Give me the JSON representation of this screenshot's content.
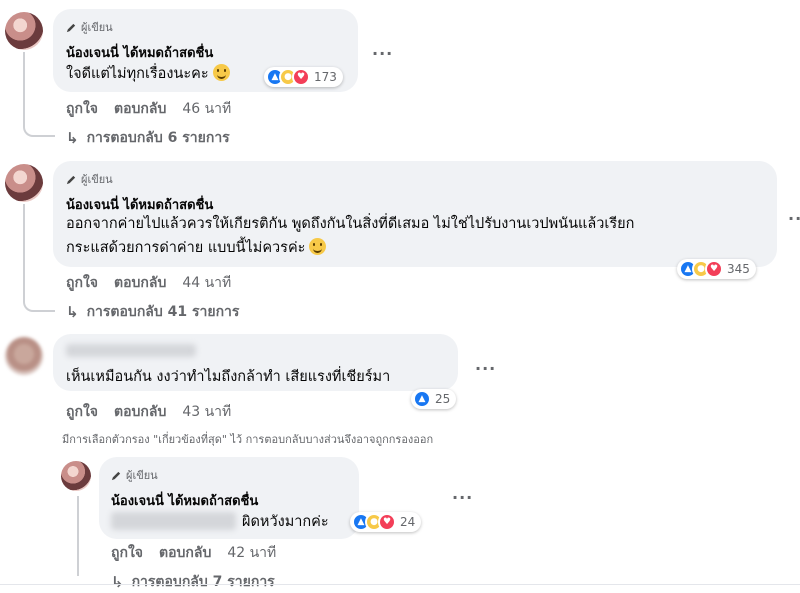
{
  "comments": [
    {
      "author_tag": "ผู้เขียน",
      "author": "น้องเจนนี่ ได้หมดถ้าสดชื่น",
      "lines": [
        "ใจดีแต่ไม่ทุกเรื่องนะคะ"
      ],
      "reaction_count": "173",
      "like_label": "ถูกใจ",
      "reply_label": "ตอบกลับ",
      "time": "46 นาที",
      "replies_text": "การตอบกลับ 6 รายการ"
    },
    {
      "author_tag": "ผู้เขียน",
      "author": "น้องเจนนี่ ได้หมดถ้าสดชื่น",
      "lines": [
        "ออกจากค่ายไปแล้วควรให้เกียรติกัน พูดถึงกันในสิ่งที่ดีเสมอ ไม่ใช่ไปรับงานเวปพนันแล้วเรียก",
        "กระแสด้วยการด่าค่าย แบบนี้ไม่ควรค่ะ"
      ],
      "reaction_count": "345",
      "like_label": "ถูกใจ",
      "reply_label": "ตอบกลับ",
      "time": "44 นาที",
      "replies_text": "การตอบกลับ 41 รายการ"
    },
    {
      "lines": [
        "เห็นเหมือนกัน งงว่าทำไมถึงกล้าทำ เสียแรงที่เชียร์มา"
      ],
      "reaction_count": "25",
      "like_label": "ถูกใจ",
      "reply_label": "ตอบกลับ",
      "time": "43 นาที"
    },
    {
      "author_tag": "ผู้เขียน",
      "author": "น้องเจนนี่ ได้หมดถ้าสดชื่น",
      "lines": [
        "ผิดหวังมากค่ะ"
      ],
      "reaction_count": "24",
      "like_label": "ถูกใจ",
      "reply_label": "ตอบกลับ",
      "time": "42 นาที",
      "replies_text": "การตอบกลับ 7 รายการ"
    }
  ],
  "filter_note": "มีการเลือกตัวกรอง \"เกี่ยวข้องที่สุด\" ไว้ การตอบกลับบางส่วนจึงอาจถูกกรองออก",
  "more_label": "...",
  "colors": {
    "like": "#1877f2",
    "love": "#f33e58",
    "care": "#f7c948",
    "bubble": "#f0f2f5",
    "secondary_text": "#65676b"
  }
}
